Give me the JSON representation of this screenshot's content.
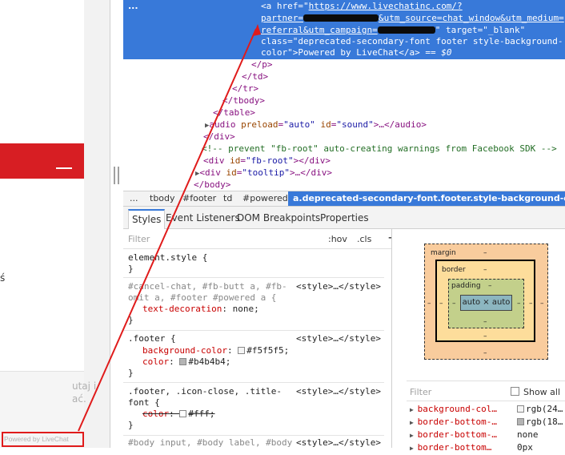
{
  "left_page": {
    "partial_char": "ś",
    "partial_text_1": "utaj i",
    "partial_text_2": "ać.",
    "powered_by": "Powered by LiveChat",
    "accent_color": "#d71e23",
    "highlight_color": "#e01b1b"
  },
  "elements": {
    "more_dots": "...",
    "link_open": "<a ",
    "href_attr": "href",
    "eq_quote": "=\"",
    "href_line1": "https://www.livechatinc.com/?",
    "href_line2_a": "partner=",
    "href_line2_b": "&utm_source=chat_window&utm_medium=",
    "href_line3_a": "referral&utm_campaign=",
    "target_attr": "\" target=\"_blank\"",
    "class_line1": "class=\"deprecated-secondary-font footer style-background-",
    "class_line2_a": "color\">",
    "link_text": "Powered by LiveChat",
    "link_close": "</a>",
    "eq_ref": " == $0",
    "close_p": "</p>",
    "close_td": "</td>",
    "close_tr": "</tr>",
    "close_tbody": "</tbody>",
    "close_table": "</table>",
    "audio_line": "audio",
    "audio_preload_attr": " preload",
    "audio_preload_val": "\"auto\"",
    "audio_id_attr": " id",
    "audio_id_val": "\"sound\"",
    "audio_rest": ">…</audio>",
    "close_div": "</div>",
    "comment": "<!-- prevent \"fb-root\" auto-creating warnings from Facebook SDK -->",
    "fbroot_open": "<div",
    "fbroot_id_attr": " id",
    "fbroot_id_val": "\"fb-root\"",
    "fbroot_close": "></div>",
    "tooltip_open": "<div",
    "tooltip_id_attr": " id",
    "tooltip_id_val": "\"tooltip\"",
    "tooltip_rest": ">…</div>",
    "close_body": "</body>"
  },
  "breadcrumbs": [
    "...",
    "tbody",
    "#footer",
    "td",
    "#powered",
    "a.deprecated-secondary-font.footer.style-background-color"
  ],
  "tabs": [
    "Styles",
    "Event Listeners",
    "DOM Breakpoints",
    "Properties"
  ],
  "styles": {
    "filter_placeholder": "Filter",
    "hov": ":hov",
    "cls": ".cls",
    "plus": "+",
    "rules": [
      {
        "selector": "element.style {",
        "close": "}"
      },
      {
        "selector_line1": "#cancel-chat, #fb-butt a, #fb-",
        "selector_line2": "omit a, #footer #powered a {",
        "source": "<style>…</style>",
        "prop": "text-decoration",
        "value": "none;",
        "close": "}"
      },
      {
        "selector": ".footer {",
        "source": "<style>…</style>",
        "prop1": "background-color",
        "value1": "#f5f5f5;",
        "swatch1": "#f5f5f5",
        "prop2": "color",
        "value2": "#b4b4b4;",
        "swatch2": "#b4b4b4",
        "close": "}"
      },
      {
        "selector_line1": ".footer, .icon-close, .title-",
        "selector_line2": "font {",
        "source": "<style>…</style>",
        "prop": "color",
        "value": "#fff;",
        "swatch": "#ffffff",
        "close": "}"
      },
      {
        "selector": "#body input, #body label, #body",
        "source": "<style>…</style>"
      }
    ]
  },
  "box_model": {
    "margin_label": "margin",
    "border_label": "border",
    "padding_label": "padding",
    "content": "auto × auto",
    "dash": "–"
  },
  "computed": {
    "filter_placeholder": "Filter",
    "show_all": "Show all",
    "props": [
      {
        "name": "background-col…",
        "value": "rgb(24…",
        "swatch": "#f5f5f5"
      },
      {
        "name": "border-bottom-…",
        "value": "rgb(18…",
        "swatch": "#b4b4b4"
      },
      {
        "name": "border-bottom-…",
        "value": "none",
        "swatch": ""
      },
      {
        "name": "border-bottom…",
        "value": "0px",
        "swatch": ""
      }
    ]
  }
}
